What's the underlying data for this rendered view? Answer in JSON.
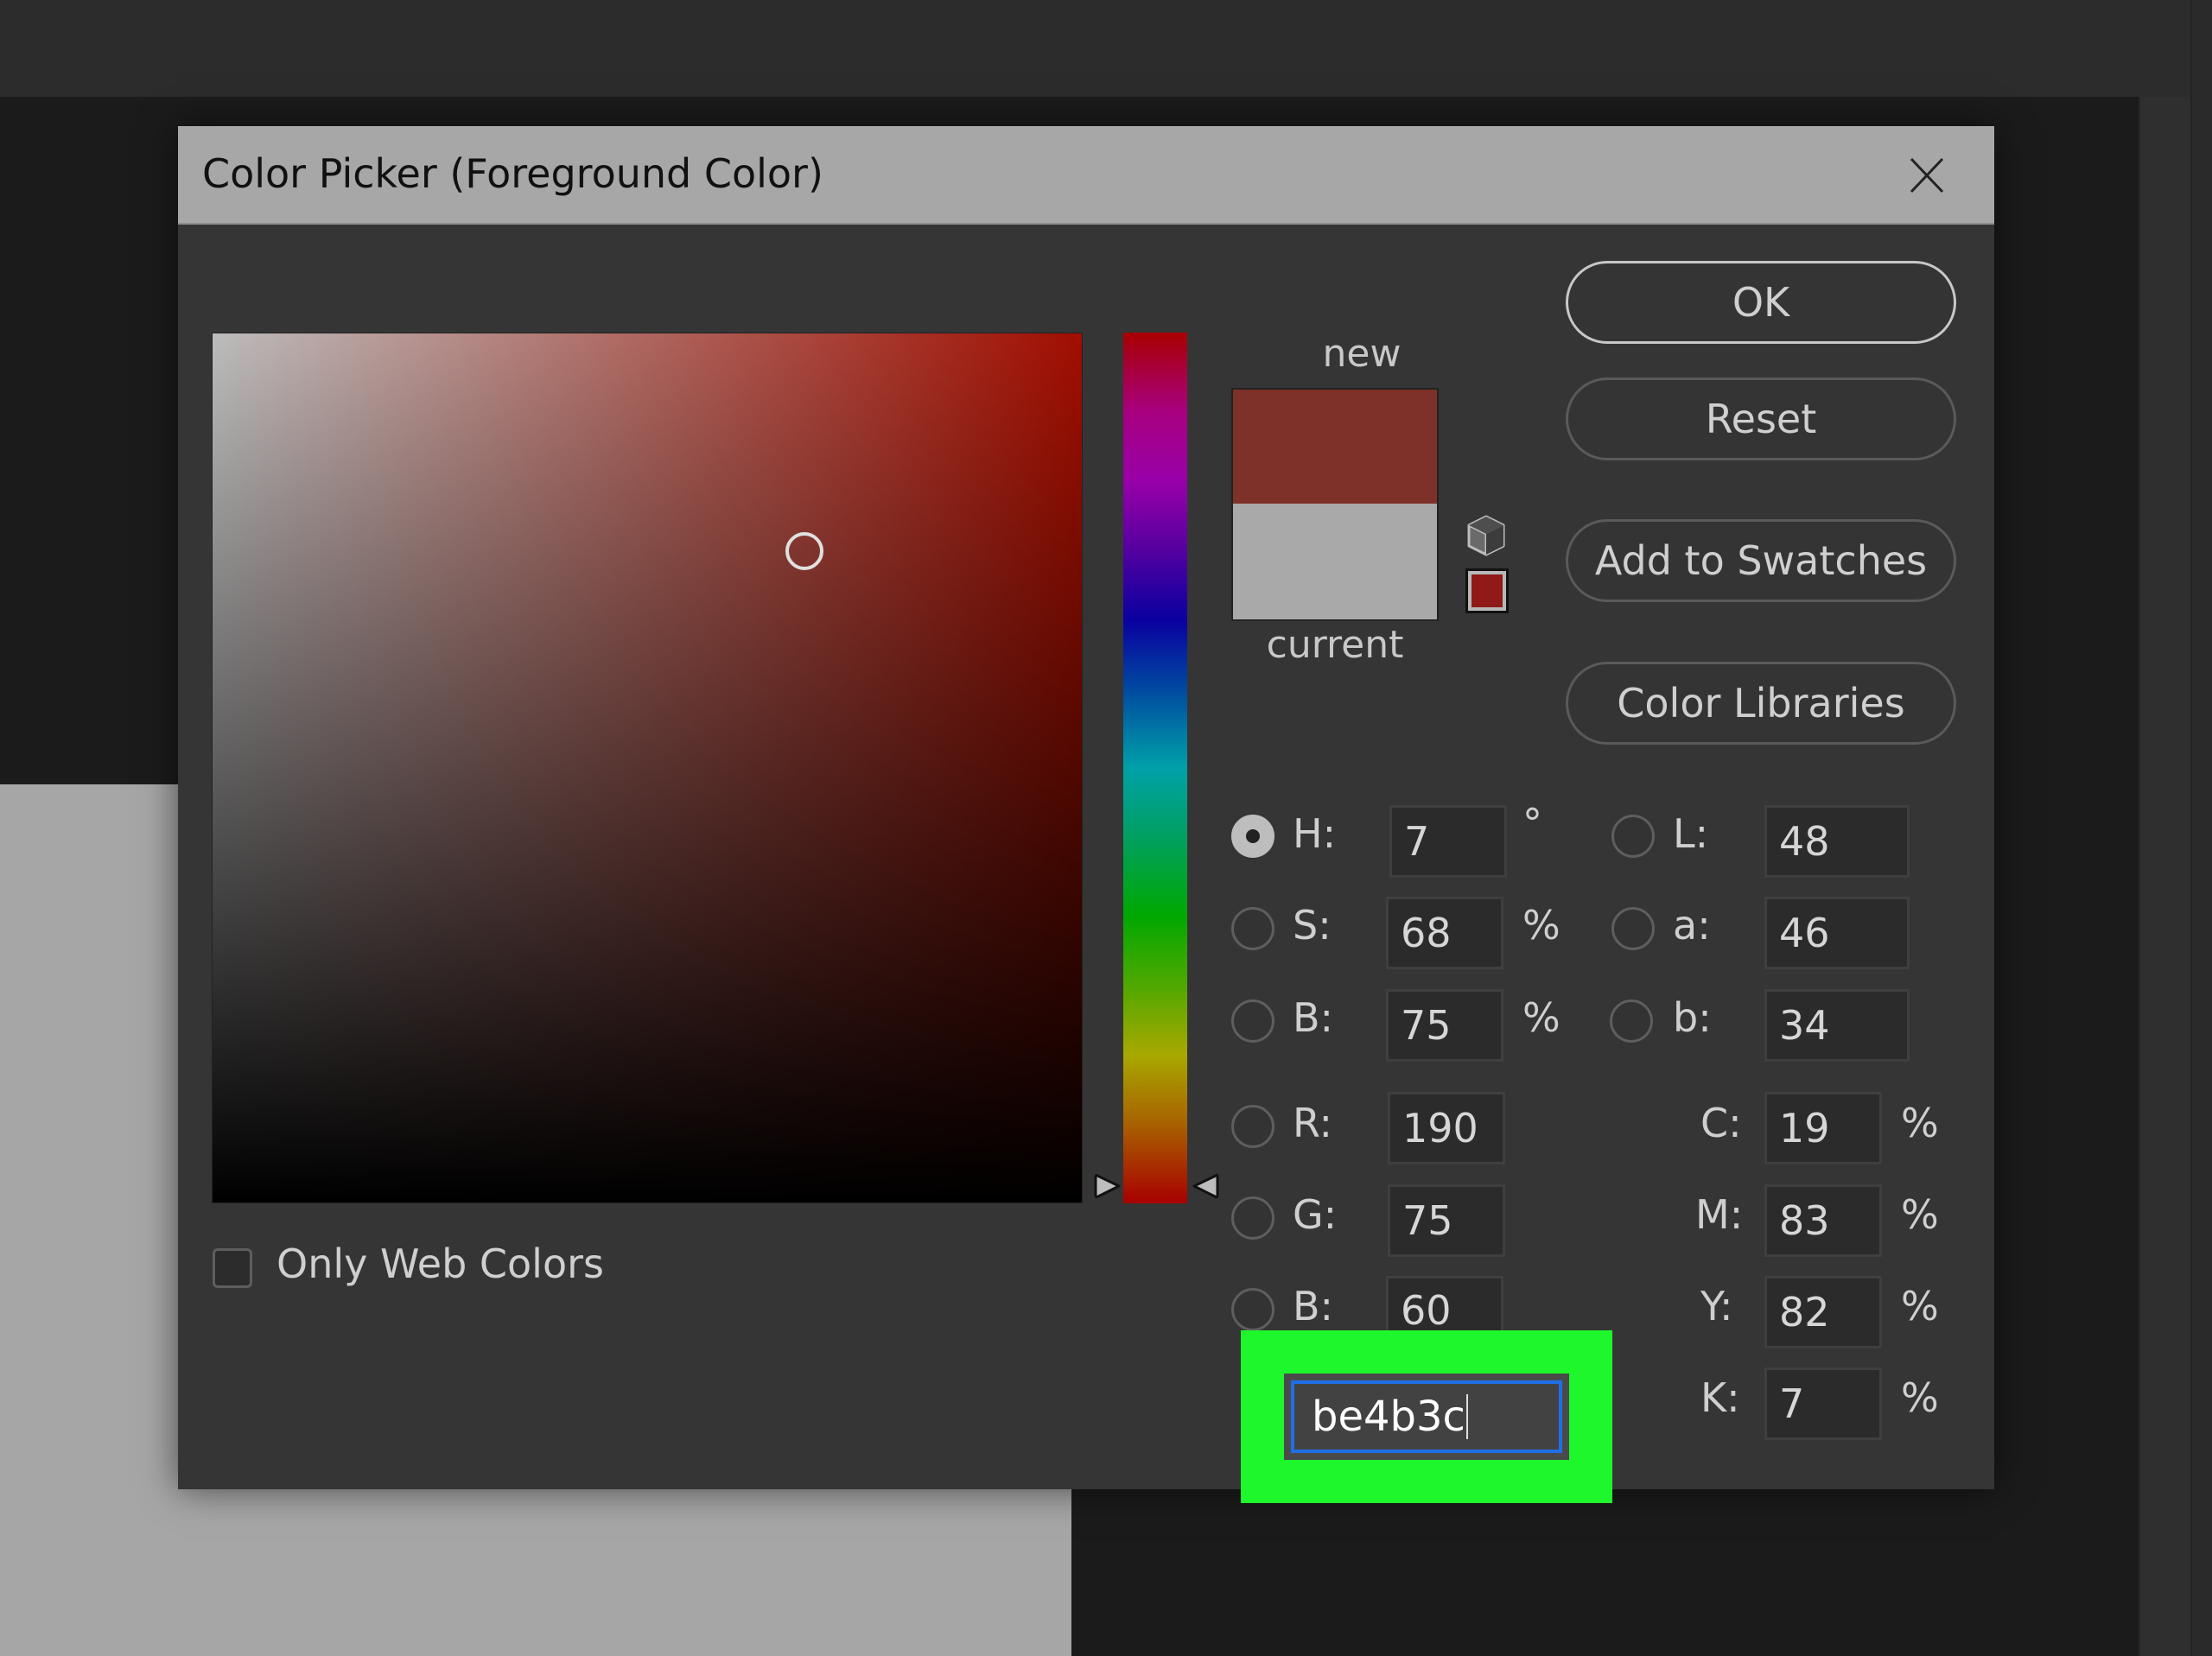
{
  "dialog": {
    "title": "Color Picker (Foreground Color)",
    "close_icon": "close-icon"
  },
  "color_field": {
    "hue_deg": 7,
    "saturation_pct": 68,
    "brightness_pct": 75
  },
  "hue_slider": {
    "value_deg": 7
  },
  "swatch": {
    "new_label": "new",
    "current_label": "current",
    "new_color": "#7e3128",
    "current_color": "#a9a9a9",
    "gamut_warning_icon": "cube-icon",
    "gamut_swatch_color": "#8f1a18"
  },
  "buttons": {
    "ok": "OK",
    "reset": "Reset",
    "add_to_swatches": "Add to Swatches",
    "color_libraries": "Color Libraries"
  },
  "hsb": {
    "h": {
      "label": "H:",
      "value": "7",
      "unit": "°",
      "selected": true
    },
    "s": {
      "label": "S:",
      "value": "68",
      "unit": "%",
      "selected": false
    },
    "b": {
      "label": "B:",
      "value": "75",
      "unit": "%",
      "selected": false
    }
  },
  "lab": {
    "l": {
      "label": "L:",
      "value": "48"
    },
    "a": {
      "label": "a:",
      "value": "46"
    },
    "b": {
      "label": "b:",
      "value": "34"
    }
  },
  "rgb": {
    "r": {
      "label": "R:",
      "value": "190"
    },
    "g": {
      "label": "G:",
      "value": "75"
    },
    "b": {
      "label": "B:",
      "value": "60"
    }
  },
  "cmyk": {
    "c": {
      "label": "C:",
      "value": "19",
      "unit": "%"
    },
    "m": {
      "label": "M:",
      "value": "83",
      "unit": "%"
    },
    "y": {
      "label": "Y:",
      "value": "82",
      "unit": "%"
    },
    "k": {
      "label": "K:",
      "value": "7",
      "unit": "%"
    }
  },
  "hex": {
    "value": "be4b3c"
  },
  "only_web_colors": {
    "label": "Only Web Colors",
    "checked": false
  },
  "colors": {
    "highlight": "#1ef72c",
    "focus_ring": "#1f6fe6"
  }
}
